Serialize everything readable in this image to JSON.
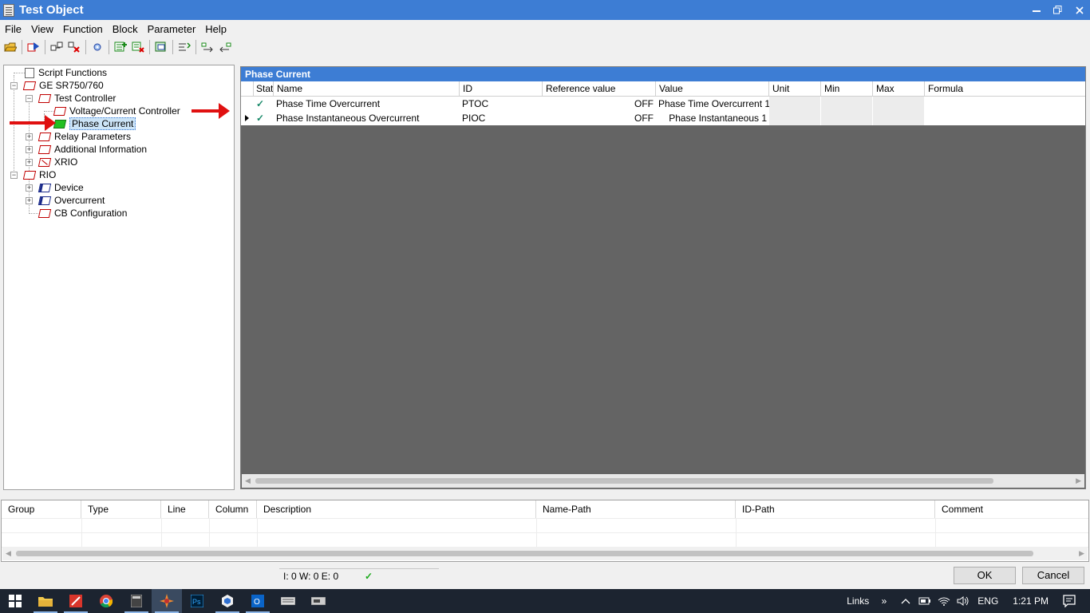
{
  "window": {
    "title": "Test Object"
  },
  "menu": [
    {
      "label": "File"
    },
    {
      "label": "View"
    },
    {
      "label": "Function"
    },
    {
      "label": "Block"
    },
    {
      "label": "Parameter"
    },
    {
      "label": "Help"
    }
  ],
  "tree": {
    "items": [
      {
        "label": "Script Functions",
        "icon": "script-icon"
      },
      {
        "label": "GE SR750/760",
        "icon": "block-red-icon"
      },
      {
        "label": "Test Controller",
        "icon": "block-red-icon"
      },
      {
        "label": "Voltage/Current Controller",
        "icon": "block-red-icon"
      },
      {
        "label": "Phase Current",
        "icon": "block-green-icon"
      },
      {
        "label": "Relay Parameters",
        "icon": "block-red-icon"
      },
      {
        "label": "Additional Information",
        "icon": "block-red-icon"
      },
      {
        "label": "XRIO",
        "icon": "xrio-icon"
      },
      {
        "label": "RIO",
        "icon": "block-red-icon"
      },
      {
        "label": "Device",
        "icon": "block-navy-icon"
      },
      {
        "label": "Overcurrent",
        "icon": "block-navy-icon"
      },
      {
        "label": "CB Configuration",
        "icon": "block-red-icon"
      }
    ]
  },
  "grid": {
    "title": "Phase Current",
    "columns": [
      "Stat",
      "Name",
      "ID",
      "Reference value",
      "Value",
      "Unit",
      "Min",
      "Max",
      "Formula"
    ],
    "rows": [
      {
        "stat": "✓",
        "name": "Phase Time Overcurrent",
        "id": "PTOC",
        "ref": "OFF",
        "value": "Phase Time Overcurrent 1",
        "unit": "",
        "min": "",
        "max": "",
        "formula": ""
      },
      {
        "stat": "✓",
        "name": "Phase Instantaneous Overcurrent",
        "id": "PIOC",
        "ref": "OFF",
        "value": "Phase Instantaneous 1",
        "unit": "",
        "min": "",
        "max": "",
        "formula": ""
      }
    ]
  },
  "messages": {
    "columns": [
      "Group",
      "Type",
      "Line",
      "Column",
      "Description",
      "Name-Path",
      "ID-Path",
      "Comment"
    ]
  },
  "status": {
    "counts": "I: 0 W: 0 E: 0",
    "ok_mark": "✓"
  },
  "buttons": {
    "ok": "OK",
    "cancel": "Cancel"
  },
  "taskbar": {
    "links": "Links",
    "links_chevron": "»",
    "lang": "ENG",
    "time": "1:21 PM"
  },
  "colors": {
    "titlebar": "#3d7dd4",
    "grid_bg": "#646464",
    "taskbar": "#1c2430",
    "arrow": "#e01010"
  }
}
